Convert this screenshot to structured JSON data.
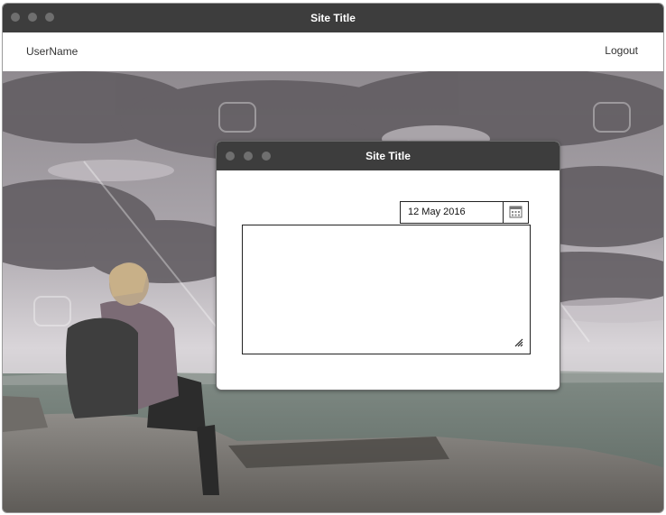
{
  "window": {
    "title": "Site Title"
  },
  "header": {
    "username": "UserName",
    "logout_label": "Logout"
  },
  "hero": {
    "image": "hiker-on-rock-landscape"
  },
  "dialog": {
    "title": "Site Title",
    "date_value": "12 May 2016",
    "date_icon": "calendar-icon",
    "textarea_value": ""
  },
  "colors": {
    "titlebar": "#3d3d3d",
    "titlebar_text": "#ffffff",
    "dot": "#6f6f6f"
  }
}
